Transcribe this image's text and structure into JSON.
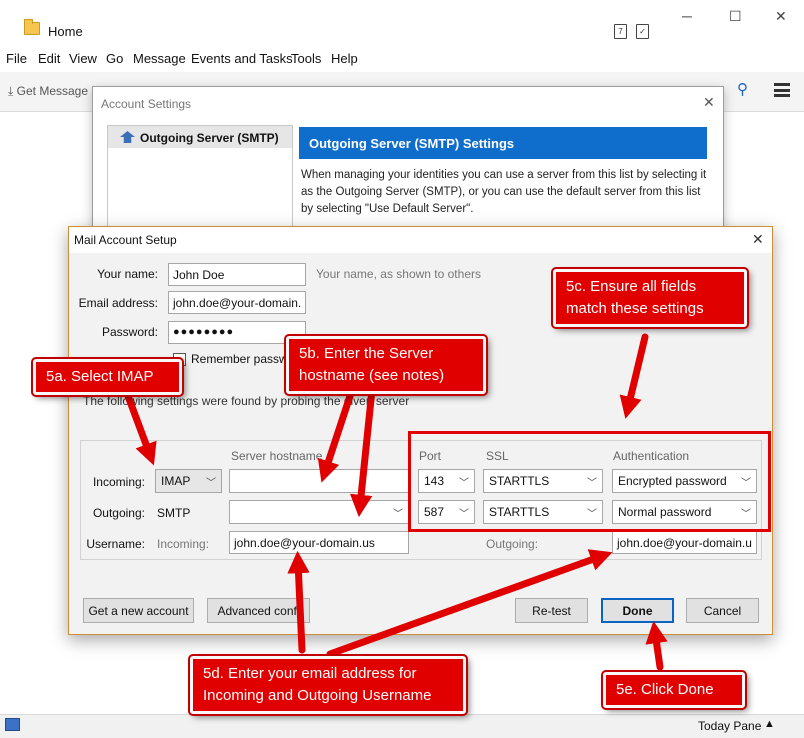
{
  "app": {
    "title": "Home",
    "menu": [
      "File",
      "Edit",
      "View",
      "Go",
      "Message",
      "Events and Tasks",
      "Tools",
      "Help"
    ],
    "toolbar_get_messages": "Get Message",
    "calendar_icon_text": "7",
    "today_pane": "Today Pane",
    "today_pane_arrow": "▲"
  },
  "window_controls": {
    "minimize": "─",
    "maximize": "☐",
    "close": "✕"
  },
  "account_settings": {
    "title": "Account Settings",
    "close": "✕",
    "list_item": "Outgoing Server (SMTP)",
    "header": "Outgoing Server (SMTP) Settings",
    "description": "When managing your identities you can use a server from this list by selecting it as the Outgoing Server (SMTP), or you can use the default server from this list by selecting \"Use Default Server\"."
  },
  "mail_setup": {
    "title": "Mail Account Setup",
    "close": "✕",
    "your_name_label": "Your name:",
    "your_name_value": "John Doe",
    "your_name_hint": "Your name, as shown to others",
    "email_label": "Email address:",
    "email_value": "john.doe@your-domain.",
    "password_label": "Password:",
    "password_value": "●●●●●●●●",
    "remember_label": "Remember passw",
    "found_text": "The following settings were found by probing the given server",
    "col_server": "Server hostname",
    "col_port": "Port",
    "col_ssl": "SSL",
    "col_auth": "Authentication",
    "incoming_label": "Incoming:",
    "incoming_protocol": "IMAP",
    "incoming_port": "143",
    "incoming_ssl": "STARTTLS",
    "incoming_auth": "Encrypted password",
    "outgoing_label": "Outgoing:",
    "outgoing_protocol": "SMTP",
    "outgoing_port": "587",
    "outgoing_ssl": "STARTTLS",
    "outgoing_auth": "Normal password",
    "username_label": "Username:",
    "username_incoming_label": "Incoming:",
    "username_incoming_value": "john.doe@your-domain.us",
    "username_outgoing_label": "Outgoing:",
    "username_outgoing_value": "john.doe@your-domain.u",
    "btn_get_account": "Get a new account",
    "btn_advanced": "Advanced confi",
    "btn_retest": "Re-test",
    "btn_done": "Done",
    "btn_cancel": "Cancel"
  },
  "callouts": {
    "c5a": "5a. Select IMAP",
    "c5b": "5b. Enter the Server hostname (see notes)",
    "c5c": "5c. Ensure all fields match these settings",
    "c5d": "5d. Enter your email address for Incoming and Outgoing Username",
    "c5e": "5e. Click Done"
  },
  "colors": {
    "callout_red": "#e00000",
    "accent_blue": "#0f6dcc",
    "dialog_border": "#cf8d36"
  }
}
